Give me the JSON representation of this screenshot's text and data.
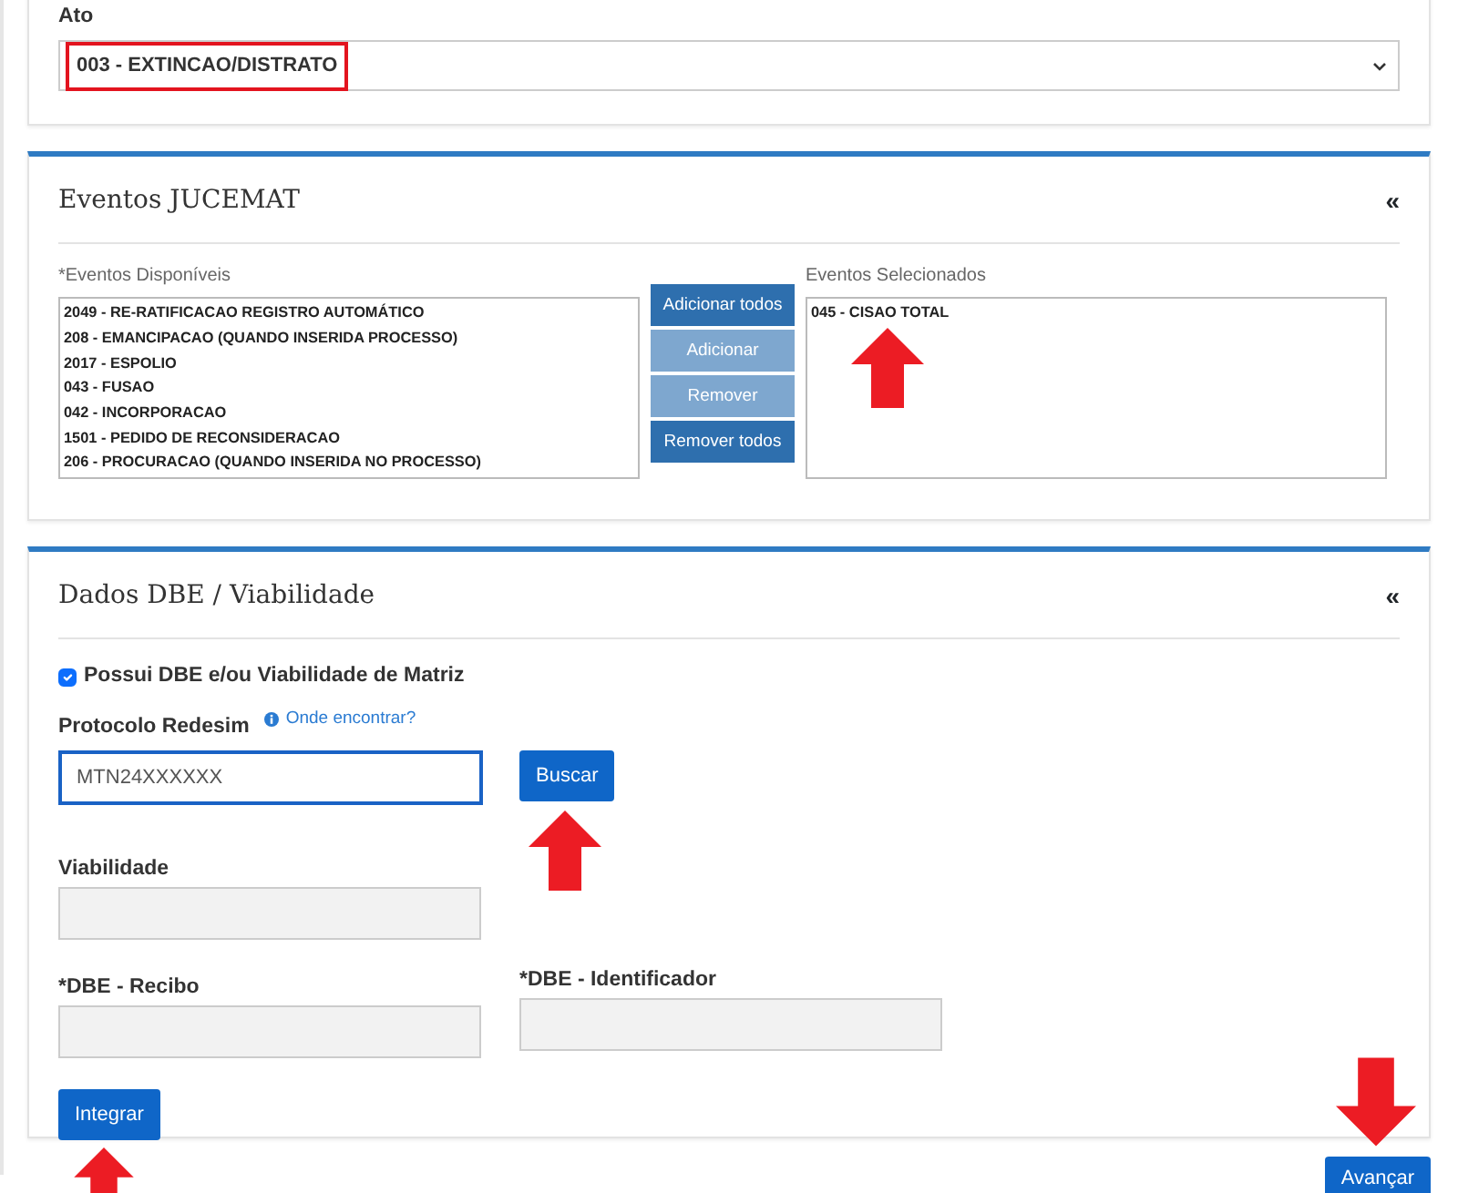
{
  "ato": {
    "label": "Ato",
    "value": "003 - EXTINCAO/DISTRATO",
    "highlighted": true
  },
  "eventos": {
    "title": "Eventos JUCEMAT",
    "collapse": "«",
    "available_label": "*Eventos Disponíveis",
    "available": [
      "2049 - RE-RATIFICACAO REGISTRO AUTOMÁTICO",
      "208 - EMANCIPACAO (QUANDO INSERIDA PROCESSO)",
      "2017 - ESPOLIO",
      "043 - FUSAO",
      "042 - INCORPORACAO",
      "1501 - PEDIDO DE RECONSIDERACAO",
      "206 - PROCURACAO (QUANDO INSERIDA NO PROCESSO)"
    ],
    "buttons": [
      {
        "label": "Adicionar todos",
        "disabled": false
      },
      {
        "label": "Adicionar",
        "disabled": true
      },
      {
        "label": "Remover",
        "disabled": true
      },
      {
        "label": "Remover todos",
        "disabled": false
      }
    ],
    "selected_label": "Eventos Selecionados",
    "selected_items": [
      "045 - CISAO TOTAL"
    ],
    "selected_arrow": true
  },
  "dbe": {
    "title": "Dados DBE / Viabilidade",
    "collapse": "«",
    "checkbox": {
      "label": "Possui DBE e/ou Viabilidade de Matriz",
      "checked": true
    },
    "protocolo": {
      "label": "Protocolo Redesim",
      "help": "Onde encontrar?",
      "value": "MTN24XXXXXX"
    },
    "buscar": {
      "label": "Buscar",
      "arrow": true
    },
    "viabilidade": {
      "label": "Viabilidade"
    },
    "recibo": {
      "label": "*DBE - Recibo"
    },
    "identificador": {
      "label": "*DBE - Identificador"
    },
    "integrar": {
      "label": "Integrar",
      "arrow": true
    }
  },
  "avancar": {
    "label": "Avançar",
    "arrow": true
  }
}
